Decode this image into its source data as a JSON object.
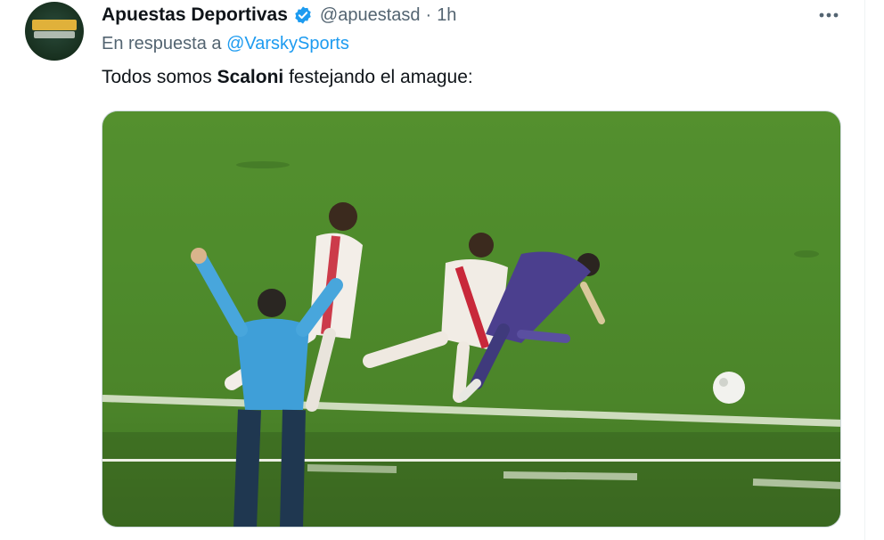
{
  "account": {
    "display_name": "Apuestas Deportivas",
    "handle": "@apuestasd",
    "separator": "·",
    "time": "1h",
    "avatar_icon": "apuestas-deportivas-logo",
    "verified_color": "#1d9bf0"
  },
  "reply": {
    "prefix": "En respuesta a ",
    "to": "@VarskySports"
  },
  "text": {
    "before": "Todos somos ",
    "bold": "Scaloni",
    "after": " festejando el amague:"
  },
  "more_icon": "more-horizontal-icon",
  "colors": {
    "link": "#1d9bf0",
    "secondary": "#536471",
    "primary": "#0f1419",
    "pitch": "#4e8a2b"
  }
}
